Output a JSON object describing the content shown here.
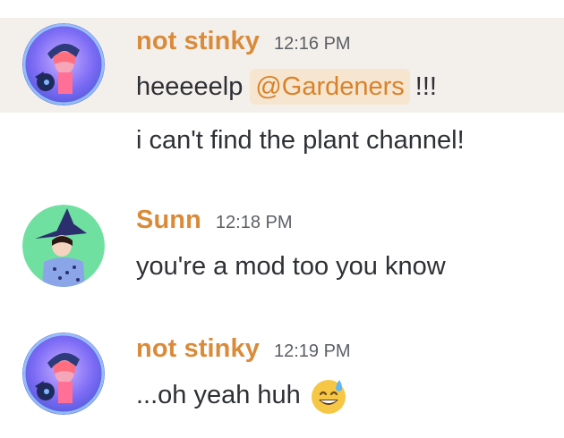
{
  "messages": [
    {
      "author": "not stinky",
      "time": "12:16 PM",
      "line1_prefix": "heeeeelp",
      "mention": "@Gardeners",
      "line1_suffix": "!!!",
      "line2": "i can't find the plant channel!"
    },
    {
      "author": "Sunn",
      "time": "12:18 PM",
      "text": "you're a mod too you know"
    },
    {
      "author": "not stinky",
      "time": "12:19 PM",
      "text": "...oh yeah huh",
      "emoji": "sweat-smile-emoji"
    }
  ],
  "colors": {
    "username": "#d98b3a",
    "mention_bg": "#f6e6cf",
    "mention_text": "#d9822b",
    "highlight_bg": "#f3efeb",
    "text": "#2e3035",
    "timestamp": "#5d5f66"
  }
}
